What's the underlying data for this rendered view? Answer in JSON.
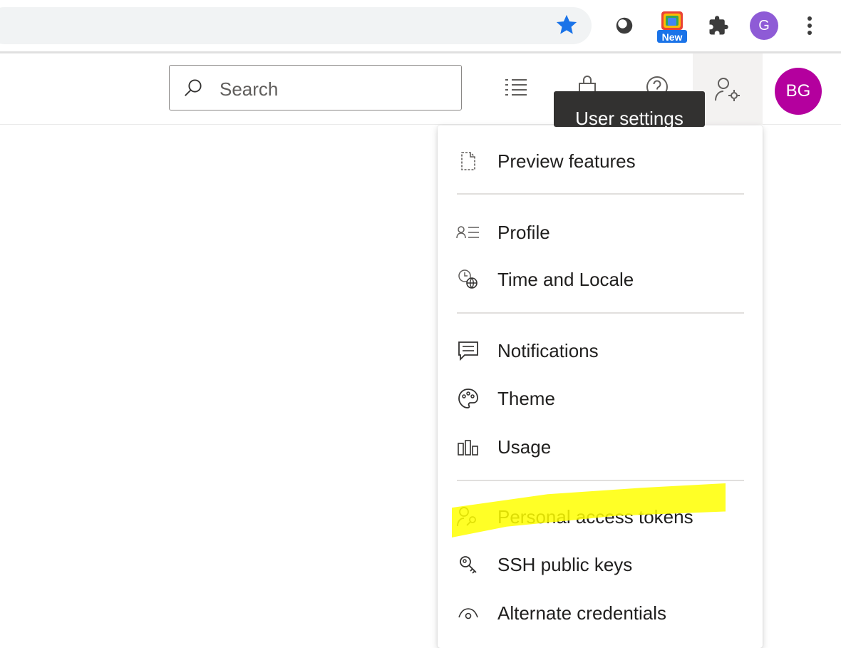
{
  "browser": {
    "new_badge": "New",
    "profile_initial": "G",
    "accent": "#1a73e8"
  },
  "header": {
    "search": {
      "placeholder": "Search"
    },
    "user_initials": "BG",
    "avatar_color": "#b4009e",
    "tooltip": "User settings",
    "icons": [
      "work-items-icon",
      "marketplace-bag-icon",
      "help-icon",
      "user-settings-icon"
    ]
  },
  "menu": {
    "items": [
      {
        "label": "Preview features",
        "icon": "document-icon"
      },
      {
        "label": "Profile",
        "icon": "profile-icon"
      },
      {
        "label": "Time and Locale",
        "icon": "time-locale-icon"
      },
      {
        "label": "Notifications",
        "icon": "notifications-icon"
      },
      {
        "label": "Theme",
        "icon": "palette-icon"
      },
      {
        "label": "Usage",
        "icon": "usage-chart-icon"
      },
      {
        "label": "Personal access tokens",
        "icon": "personal-token-icon"
      },
      {
        "label": "SSH public keys",
        "icon": "key-icon"
      },
      {
        "label": "Alternate credentials",
        "icon": "eye-icon"
      }
    ],
    "highlight_color": "#ffff00"
  }
}
